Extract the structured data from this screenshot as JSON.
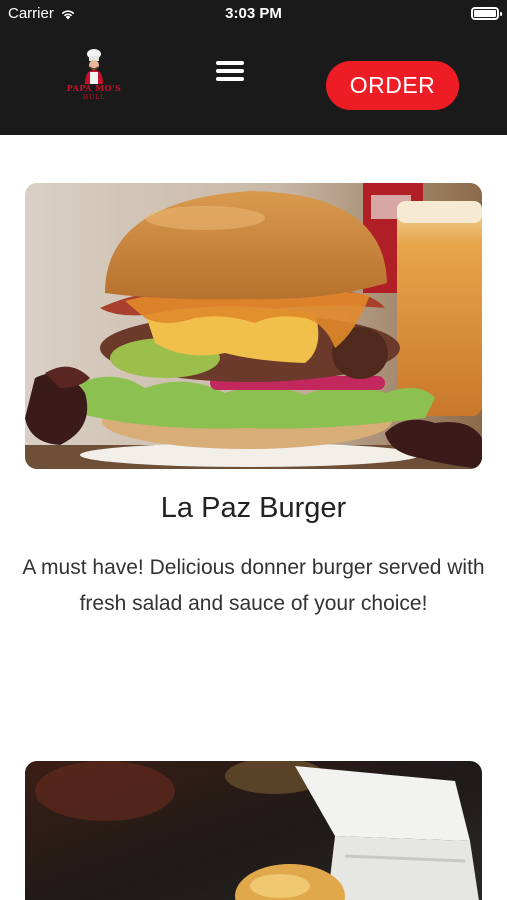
{
  "status_bar": {
    "carrier": "Carrier",
    "time": "3:03 PM",
    "wifi_icon": "wifi-icon",
    "battery_icon": "battery-icon"
  },
  "header": {
    "logo_text": "PAPA MO'S",
    "logo_subtext": "HULL",
    "menu_icon": "hamburger-menu-icon",
    "order_label": "ORDER",
    "background": "#1a1a1a",
    "accent": "#ee1c25"
  },
  "items": [
    {
      "title": "La Paz Burger",
      "description": "A must have! Delicious donner burger served with fresh salad and sauce of your choice!",
      "image": "burger-photo"
    },
    {
      "image": "food-box-photo"
    }
  ]
}
